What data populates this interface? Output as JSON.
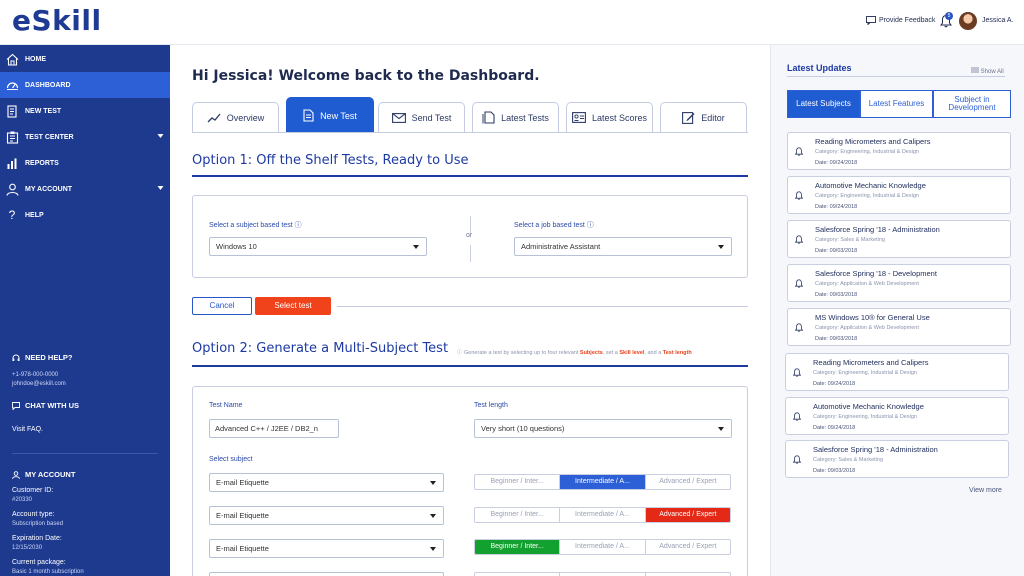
{
  "header": {
    "logo": "eSkill",
    "feedback": "Provide Feedback",
    "notification_count": "5",
    "user": "Jessica A."
  },
  "sidebar": {
    "items": [
      {
        "label": "HOME",
        "icon": "home-icon"
      },
      {
        "label": "DASHBOARD",
        "icon": "dashboard-icon"
      },
      {
        "label": "NEW TEST",
        "icon": "new-test-icon"
      },
      {
        "label": "TEST CENTER",
        "icon": "test-center-icon"
      },
      {
        "label": "REPORTS",
        "icon": "reports-icon"
      },
      {
        "label": "MY ACCOUNT",
        "icon": "user-icon"
      },
      {
        "label": "HELP",
        "icon": "help-icon"
      }
    ],
    "need_help": "NEED HELP?",
    "phone": "+1-978-000-0000",
    "email": "johndoe@eskill.com",
    "chat": "CHAT WITH US",
    "faq": "Visit FAQ.",
    "account_title": "MY ACCOUNT",
    "customer_id_label": "Customer ID:",
    "customer_id": "#20330",
    "account_type_label": "Account type:",
    "account_type": "Subscription based",
    "expiration_label": "Expiration Date:",
    "expiration": "12/15/2030",
    "package_label": "Current package:",
    "package": "Basic 1 month subscription"
  },
  "main": {
    "welcome": "Hi Jessica! Welcome back to the Dashboard.",
    "tabs": [
      {
        "label": "Overview",
        "icon": "chart-line-icon"
      },
      {
        "label": "New Test",
        "icon": "document-icon"
      },
      {
        "label": "Send Test",
        "icon": "envelope-icon"
      },
      {
        "label": "Latest Tests",
        "icon": "documents-icon"
      },
      {
        "label": "Latest Scores",
        "icon": "scorecard-icon"
      },
      {
        "label": "Editor",
        "icon": "edit-icon"
      }
    ],
    "option1_title": "Option 1: Off the Shelf Tests, Ready to Use",
    "subject_label": "Select a subject based test ⓘ",
    "subject_value": "Windows 10",
    "or": "or",
    "job_label": "Select a job based test ⓘ",
    "job_value": "Administrative Assistant",
    "cancel": "Cancel",
    "select_test": "Select test",
    "option2_title": "Option 2: Generate a Multi-Subject Test",
    "hint_pre": "ⓘ Generate a test by selecting up to four relevant ",
    "hint_subjects": "Subjects",
    "hint_mid": ", set a ",
    "hint_skill": "Skill level",
    "hint_and": ", and a ",
    "hint_length": "Test length",
    "test_name_label": "Test Name",
    "test_name_value": "Advanced C++ / J2EE / DB2_n",
    "test_length_label": "Test length",
    "test_length_value": "Very short (10 questions)",
    "select_subject_label": "Select subject",
    "subjects": [
      {
        "value": "E-mail Etiquette",
        "levels": [
          "Beginner / Inter...",
          "Intermediate / A...",
          "Advanced / Expert"
        ],
        "selected": 1
      },
      {
        "value": "E-mail Etiquette",
        "levels": [
          "Beginner / Inter...",
          "Intermediate / A...",
          "Advanced / Expert"
        ],
        "selected": 2
      },
      {
        "value": "E-mail Etiquette",
        "levels": [
          "Beginner / Inter...",
          "Intermediate / A...",
          "Advanced / Expert"
        ],
        "selected": 0
      }
    ]
  },
  "updates": {
    "title": "Latest Updates",
    "show_all": "Show All",
    "tabs": [
      "Latest Subjects",
      "Latest Features",
      "Subject in Development"
    ],
    "cards": [
      {
        "title": "Reading Micrometers and Calipers",
        "category": "Category: Engineering, Industrial & Design",
        "date": "Date: 09/24/2018"
      },
      {
        "title": "Automotive Mechanic Knowledge",
        "category": "Category: Engineering, Industrial & Design",
        "date": "Date: 09/24/2018"
      },
      {
        "title": "Salesforce Spring '18 - Administration",
        "category": "Category: Sales & Marketing",
        "date": "Date: 09/03/2018"
      },
      {
        "title": "Salesforce Spring '18 - Development",
        "category": "Category: Application & Web Development",
        "date": "Date: 09/03/2018"
      },
      {
        "title": "MS Windows 10® for General Use",
        "category": "Category: Application & Web Development",
        "date": "Date: 09/03/2018"
      },
      {
        "title": "Reading Micrometers and Calipers",
        "category": "Category: Engineering, Industrial & Design",
        "date": "Date: 09/24/2018"
      },
      {
        "title": "Automotive Mechanic Knowledge",
        "category": "Category: Engineering, Industrial & Design",
        "date": "Date: 09/24/2018"
      },
      {
        "title": "Salesforce Spring '18 - Administration",
        "category": "Category: Sales & Marketing",
        "date": "Date: 09/03/2018"
      }
    ],
    "view_more": "View more"
  },
  "colors": {
    "sidebar": "#1e3a8f",
    "accent": "#1f5bd1",
    "danger": "#f0421b",
    "success": "#12a02e"
  }
}
